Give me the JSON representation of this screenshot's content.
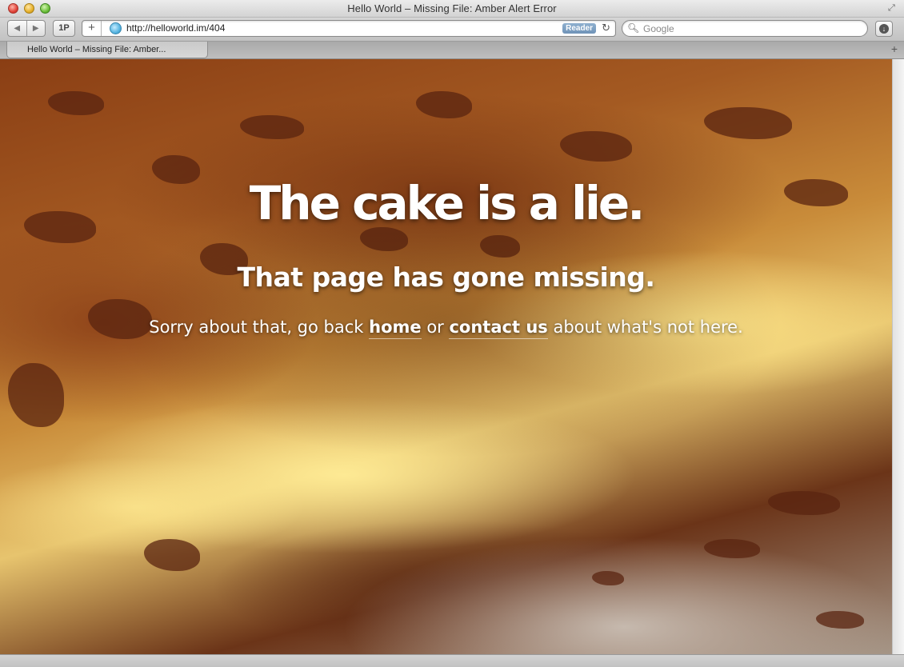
{
  "window": {
    "title": "Hello World – Missing File: Amber Alert Error"
  },
  "toolbar": {
    "onepassword_label": "1P",
    "add_label": "+",
    "url": "http://helloworld.im/404",
    "reader_label": "Reader",
    "search_placeholder": "Google"
  },
  "tabs": [
    {
      "label": "Hello World – Missing File: Amber..."
    }
  ],
  "page": {
    "headline": "The cake is a lie.",
    "subheadline": "That page has gone missing.",
    "message_prefix": "Sorry about that, go back ",
    "home_link": "home",
    "message_middle": " or ",
    "contact_link": "contact us",
    "message_suffix": " about what's not here."
  },
  "icons": [
    "back-arrow-icon",
    "forward-arrow-icon",
    "site-favicon-icon",
    "reload-icon",
    "search-icon",
    "download-icon",
    "new-tab-icon",
    "fullscreen-icon"
  ]
}
